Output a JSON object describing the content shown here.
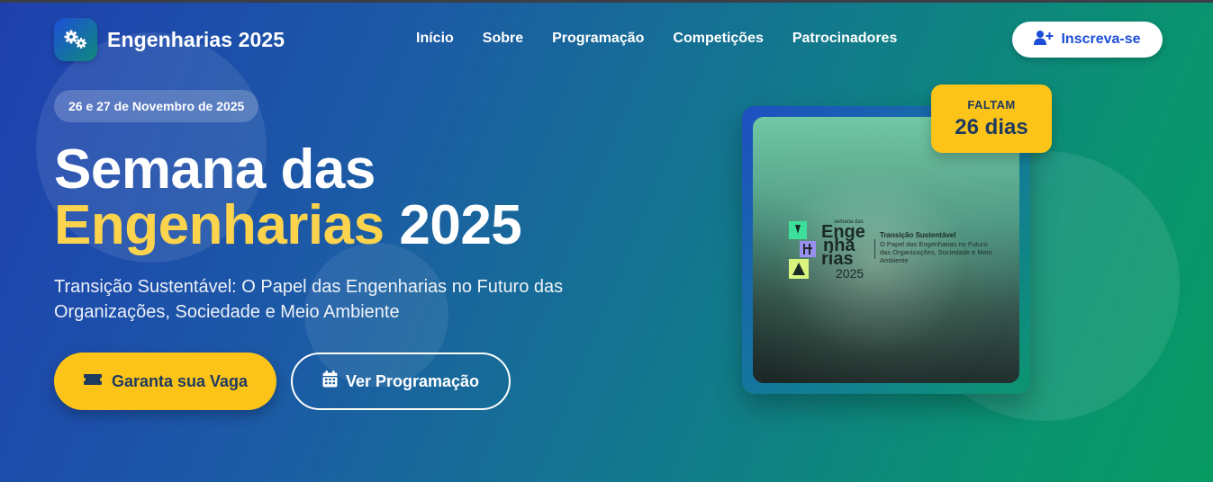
{
  "brand": {
    "name": "Engenharias 2025",
    "icon": "gears-icon"
  },
  "nav": {
    "items": [
      {
        "label": "Início"
      },
      {
        "label": "Sobre"
      },
      {
        "label": "Programação"
      },
      {
        "label": "Competições"
      },
      {
        "label": "Patrocinadores"
      }
    ]
  },
  "signup": {
    "label": "Inscreva-se",
    "icon": "user-plus-icon"
  },
  "hero": {
    "date": "26 e 27 de Novembro de 2025",
    "title_line1": "Semana das",
    "title_highlight": "Engenharias",
    "title_year": "2025",
    "subtitle": "Transição Sustentável: O Papel das Engenharias no Futuro das Organizações, Sociedade e Meio Ambiente",
    "cta_primary": {
      "label": "Garanta sua Vaga",
      "icon": "ticket-icon"
    },
    "cta_secondary": {
      "label": "Ver Programação",
      "icon": "calendar-icon"
    }
  },
  "poster": {
    "kicker": "semana das",
    "word1": "Enge",
    "word2": "nha",
    "word3": "rias",
    "year": "2025",
    "tagline_title": "Transição Sustentável",
    "tagline": "O Papel das Engenharias no Futuro das Organizações, Sociedade e Meio Ambiente"
  },
  "countdown": {
    "label": "FALTAM",
    "value": "26 dias"
  },
  "colors": {
    "accent_yellow": "#fcc419",
    "highlight_text": "#fcd34d",
    "brand_blue": "#1d4ed8",
    "gradient_start": "#1e40af",
    "gradient_end": "#079a62"
  }
}
